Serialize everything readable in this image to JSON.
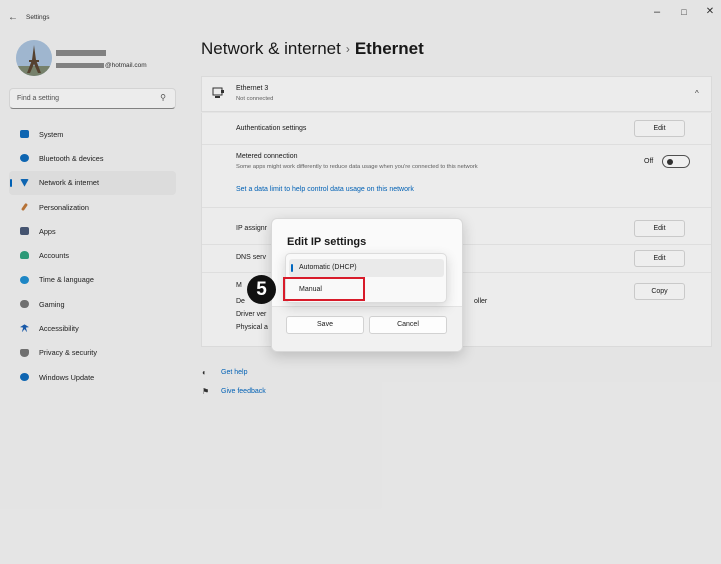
{
  "titlebar": {
    "back_icon": "←",
    "title": "Settings",
    "minimize": "–",
    "maximize": "□",
    "close": "✕"
  },
  "profile": {
    "email_suffix": "@hotmail.com"
  },
  "search": {
    "placeholder": "Find a setting",
    "icon": "⚲"
  },
  "sidebar": {
    "items": [
      {
        "label": "System",
        "color": "#0f6cbd"
      },
      {
        "label": "Bluetooth & devices",
        "color": "#0f6cbd"
      },
      {
        "label": "Network & internet",
        "color": "#0f6cbd"
      },
      {
        "label": "Personalization",
        "color": "#c27a3a"
      },
      {
        "label": "Apps",
        "color": "#4a5a78"
      },
      {
        "label": "Accounts",
        "color": "#2fa37f"
      },
      {
        "label": "Time & language",
        "color": "#1f8fd2"
      },
      {
        "label": "Gaming",
        "color": "#767676"
      },
      {
        "label": "Accessibility",
        "color": "#1b5fb3"
      },
      {
        "label": "Privacy & security",
        "color": "#767676"
      },
      {
        "label": "Windows Update",
        "color": "#0f6cbd"
      }
    ]
  },
  "header": {
    "parent": "Network & internet",
    "separator": "›",
    "current": "Ethernet"
  },
  "adapter": {
    "name": "Ethernet 3",
    "status": "Not connected",
    "chevron": "^"
  },
  "rows": {
    "auth_label": "Authentication settings",
    "auth_button": "Edit",
    "metered_title": "Metered connection",
    "metered_desc": "Some apps might work differently to reduce data usage when you're connected to this network",
    "metered_state": "Off",
    "data_limit_link": "Set a data limit to help control data usage on this network",
    "ip_label": "IP assignr",
    "ip_button": "Edit",
    "dns_label": "DNS serv",
    "dns_button": "Edit",
    "desc_label_1": "M",
    "desc_label_2": "De",
    "driver_label": "Driver ver",
    "physical_label": "Physical a",
    "controller_text": "oller",
    "copy_button": "Copy"
  },
  "help": {
    "get_help": "Get help",
    "give_feedback": "Give feedback"
  },
  "dialog": {
    "title": "Edit IP settings",
    "options": [
      "Automatic (DHCP)",
      "Manual"
    ],
    "save": "Save",
    "cancel": "Cancel"
  },
  "annotation": {
    "step": "5",
    "highlight_color": "#d81b2a"
  }
}
